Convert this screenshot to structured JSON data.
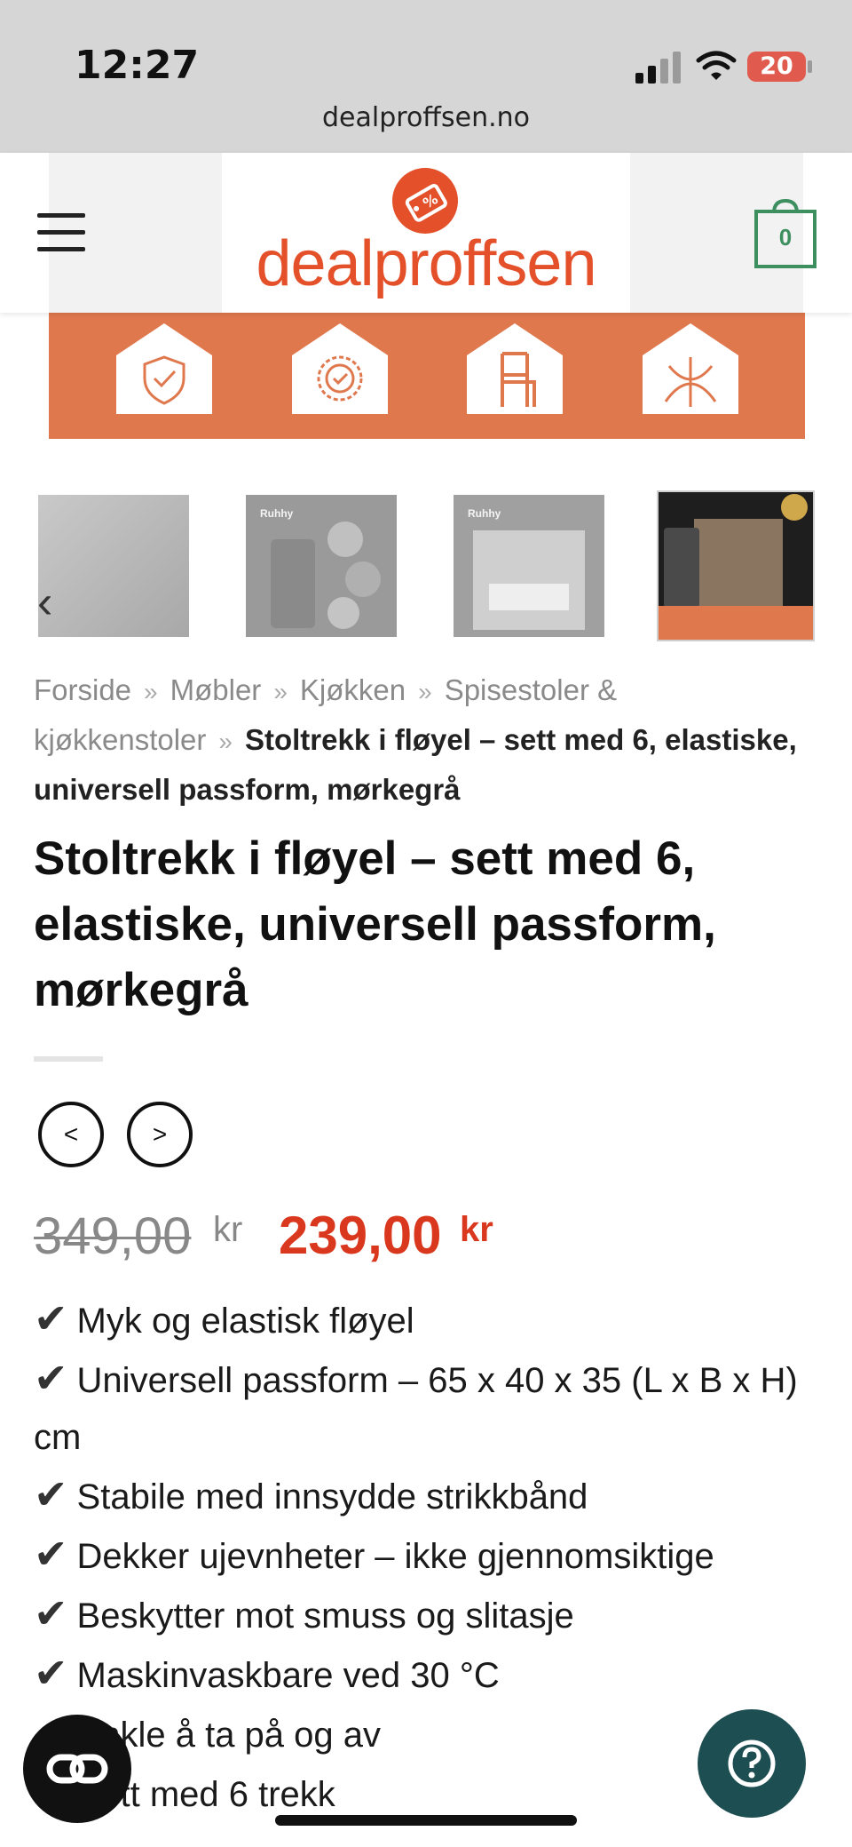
{
  "status_bar": {
    "time": "12:27",
    "url": "dealproffsen.no",
    "battery": "20"
  },
  "header": {
    "logo_text": "dealproffsen",
    "cart_count": "0",
    "menu_icon": "hamburger-icon",
    "cart_icon": "cart-icon"
  },
  "banner": {
    "icons": [
      "shield-check-icon",
      "badge-check-icon",
      "chair-icon",
      "elastic-icon"
    ]
  },
  "thumbnails": [
    {
      "name": "fabric",
      "label": ""
    },
    {
      "name": "product-details",
      "label": "Ruhhy"
    },
    {
      "name": "dining-room",
      "label": "Ruhhy"
    },
    {
      "name": "product-banner",
      "label": ""
    }
  ],
  "breadcrumb": {
    "items": [
      "Forside",
      "Møbler",
      "Kjøkken",
      "Spisestoler & kjøkkenstoler"
    ],
    "current": "Stoltrekk i fløyel – sett med 6, elastiske, universell passform, mørkegrå",
    "separator": "»"
  },
  "product": {
    "title": "Stoltrekk i fløyel – sett med 6, elastiske, universell passform, mørkegrå",
    "old_price": "349,00",
    "old_currency": "kr",
    "new_price": "239,00",
    "new_currency": "kr",
    "check_mark": "✔",
    "features": [
      "Myk og elastisk fløyel",
      "Universell passform – 65 x 40 x 35 (L x B x H) cm",
      "Stabile med innsydde strikkbånd",
      "Dekker ujevnheter – ikke gjennomsiktige",
      "Beskytter mot smuss og slitasje",
      "Maskinvaskbare ved 30 °C",
      "Enkle å ta på og av",
      "Sett med 6 trekk"
    ]
  },
  "colors": {
    "brand": "#e3502a",
    "price": "#d9381e",
    "cart": "#3d8f5f",
    "help_button": "#1d4e52"
  }
}
